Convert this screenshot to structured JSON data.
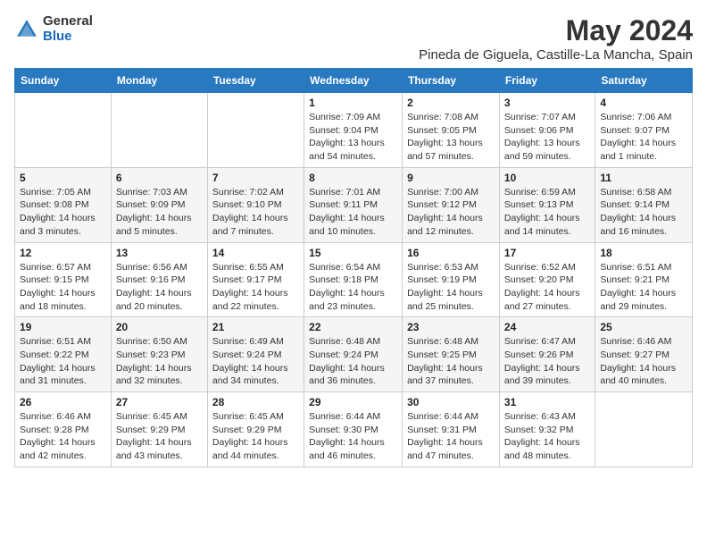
{
  "header": {
    "logo_general": "General",
    "logo_blue": "Blue",
    "month_title": "May 2024",
    "location": "Pineda de Giguela, Castille-La Mancha, Spain"
  },
  "days_of_week": [
    "Sunday",
    "Monday",
    "Tuesday",
    "Wednesday",
    "Thursday",
    "Friday",
    "Saturday"
  ],
  "weeks": [
    [
      {
        "day": "",
        "info": ""
      },
      {
        "day": "",
        "info": ""
      },
      {
        "day": "",
        "info": ""
      },
      {
        "day": "1",
        "info": "Sunrise: 7:09 AM\nSunset: 9:04 PM\nDaylight: 13 hours and 54 minutes."
      },
      {
        "day": "2",
        "info": "Sunrise: 7:08 AM\nSunset: 9:05 PM\nDaylight: 13 hours and 57 minutes."
      },
      {
        "day": "3",
        "info": "Sunrise: 7:07 AM\nSunset: 9:06 PM\nDaylight: 13 hours and 59 minutes."
      },
      {
        "day": "4",
        "info": "Sunrise: 7:06 AM\nSunset: 9:07 PM\nDaylight: 14 hours and 1 minute."
      }
    ],
    [
      {
        "day": "5",
        "info": "Sunrise: 7:05 AM\nSunset: 9:08 PM\nDaylight: 14 hours and 3 minutes."
      },
      {
        "day": "6",
        "info": "Sunrise: 7:03 AM\nSunset: 9:09 PM\nDaylight: 14 hours and 5 minutes."
      },
      {
        "day": "7",
        "info": "Sunrise: 7:02 AM\nSunset: 9:10 PM\nDaylight: 14 hours and 7 minutes."
      },
      {
        "day": "8",
        "info": "Sunrise: 7:01 AM\nSunset: 9:11 PM\nDaylight: 14 hours and 10 minutes."
      },
      {
        "day": "9",
        "info": "Sunrise: 7:00 AM\nSunset: 9:12 PM\nDaylight: 14 hours and 12 minutes."
      },
      {
        "day": "10",
        "info": "Sunrise: 6:59 AM\nSunset: 9:13 PM\nDaylight: 14 hours and 14 minutes."
      },
      {
        "day": "11",
        "info": "Sunrise: 6:58 AM\nSunset: 9:14 PM\nDaylight: 14 hours and 16 minutes."
      }
    ],
    [
      {
        "day": "12",
        "info": "Sunrise: 6:57 AM\nSunset: 9:15 PM\nDaylight: 14 hours and 18 minutes."
      },
      {
        "day": "13",
        "info": "Sunrise: 6:56 AM\nSunset: 9:16 PM\nDaylight: 14 hours and 20 minutes."
      },
      {
        "day": "14",
        "info": "Sunrise: 6:55 AM\nSunset: 9:17 PM\nDaylight: 14 hours and 22 minutes."
      },
      {
        "day": "15",
        "info": "Sunrise: 6:54 AM\nSunset: 9:18 PM\nDaylight: 14 hours and 23 minutes."
      },
      {
        "day": "16",
        "info": "Sunrise: 6:53 AM\nSunset: 9:19 PM\nDaylight: 14 hours and 25 minutes."
      },
      {
        "day": "17",
        "info": "Sunrise: 6:52 AM\nSunset: 9:20 PM\nDaylight: 14 hours and 27 minutes."
      },
      {
        "day": "18",
        "info": "Sunrise: 6:51 AM\nSunset: 9:21 PM\nDaylight: 14 hours and 29 minutes."
      }
    ],
    [
      {
        "day": "19",
        "info": "Sunrise: 6:51 AM\nSunset: 9:22 PM\nDaylight: 14 hours and 31 minutes."
      },
      {
        "day": "20",
        "info": "Sunrise: 6:50 AM\nSunset: 9:23 PM\nDaylight: 14 hours and 32 minutes."
      },
      {
        "day": "21",
        "info": "Sunrise: 6:49 AM\nSunset: 9:24 PM\nDaylight: 14 hours and 34 minutes."
      },
      {
        "day": "22",
        "info": "Sunrise: 6:48 AM\nSunset: 9:24 PM\nDaylight: 14 hours and 36 minutes."
      },
      {
        "day": "23",
        "info": "Sunrise: 6:48 AM\nSunset: 9:25 PM\nDaylight: 14 hours and 37 minutes."
      },
      {
        "day": "24",
        "info": "Sunrise: 6:47 AM\nSunset: 9:26 PM\nDaylight: 14 hours and 39 minutes."
      },
      {
        "day": "25",
        "info": "Sunrise: 6:46 AM\nSunset: 9:27 PM\nDaylight: 14 hours and 40 minutes."
      }
    ],
    [
      {
        "day": "26",
        "info": "Sunrise: 6:46 AM\nSunset: 9:28 PM\nDaylight: 14 hours and 42 minutes."
      },
      {
        "day": "27",
        "info": "Sunrise: 6:45 AM\nSunset: 9:29 PM\nDaylight: 14 hours and 43 minutes."
      },
      {
        "day": "28",
        "info": "Sunrise: 6:45 AM\nSunset: 9:29 PM\nDaylight: 14 hours and 44 minutes."
      },
      {
        "day": "29",
        "info": "Sunrise: 6:44 AM\nSunset: 9:30 PM\nDaylight: 14 hours and 46 minutes."
      },
      {
        "day": "30",
        "info": "Sunrise: 6:44 AM\nSunset: 9:31 PM\nDaylight: 14 hours and 47 minutes."
      },
      {
        "day": "31",
        "info": "Sunrise: 6:43 AM\nSunset: 9:32 PM\nDaylight: 14 hours and 48 minutes."
      },
      {
        "day": "",
        "info": ""
      }
    ]
  ]
}
